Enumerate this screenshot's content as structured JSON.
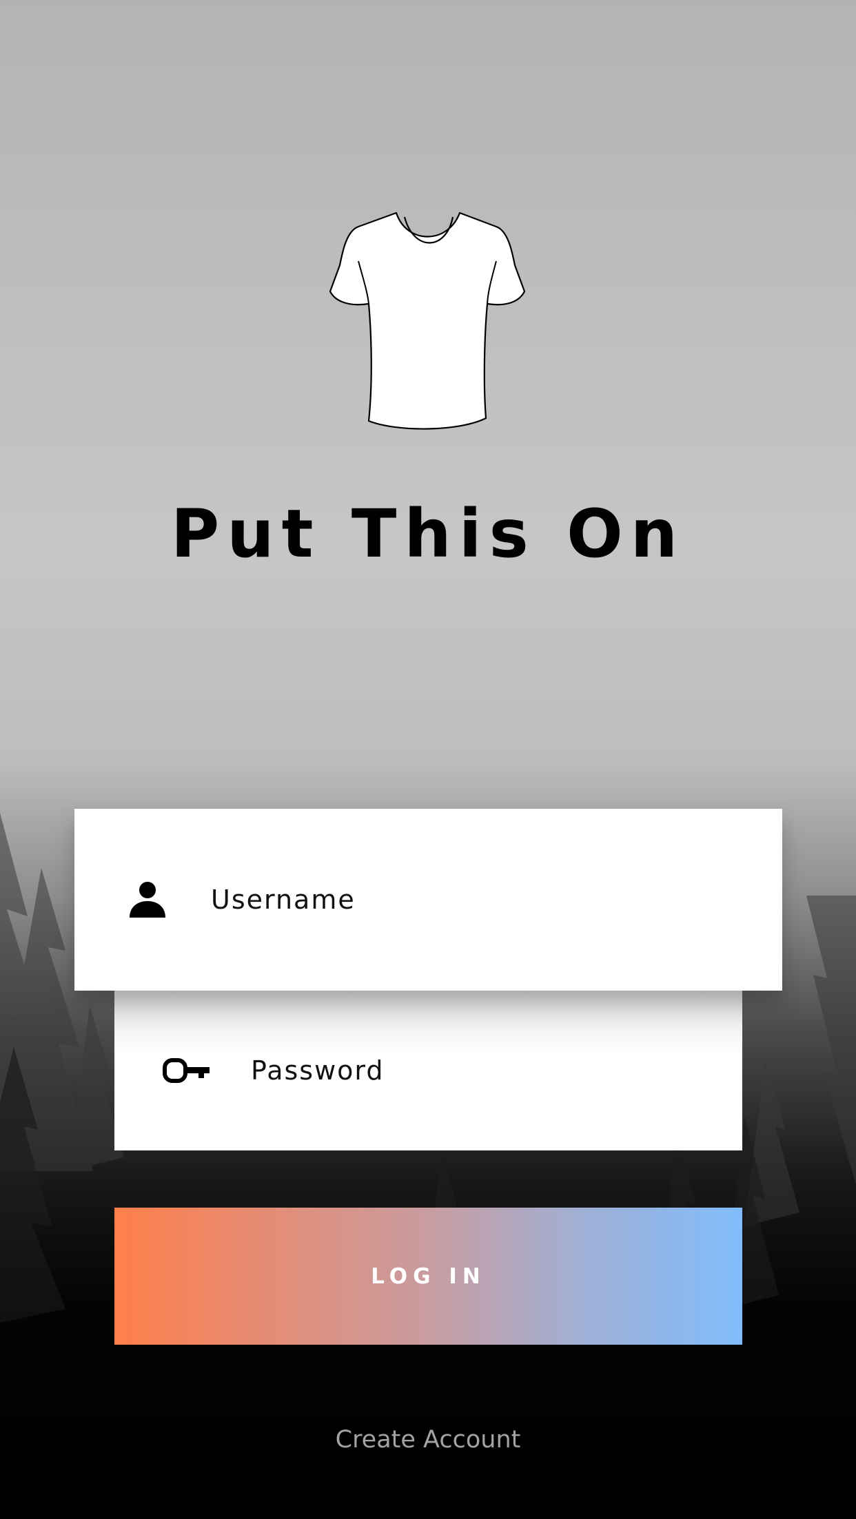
{
  "app": {
    "title": "Put This On",
    "logo_icon": "t-shirt-icon"
  },
  "form": {
    "username": {
      "placeholder": "Username",
      "value": "",
      "icon": "user-icon"
    },
    "password": {
      "placeholder": "Password",
      "value": "",
      "icon": "key-icon"
    },
    "login_label": "LOG IN",
    "create_account_label": "Create Account"
  },
  "colors": {
    "login_gradient_start": "#ff7f4a",
    "login_gradient_end": "#80bcfb",
    "create_account_text": "#a3a3a3",
    "field_background": "#ffffff"
  }
}
